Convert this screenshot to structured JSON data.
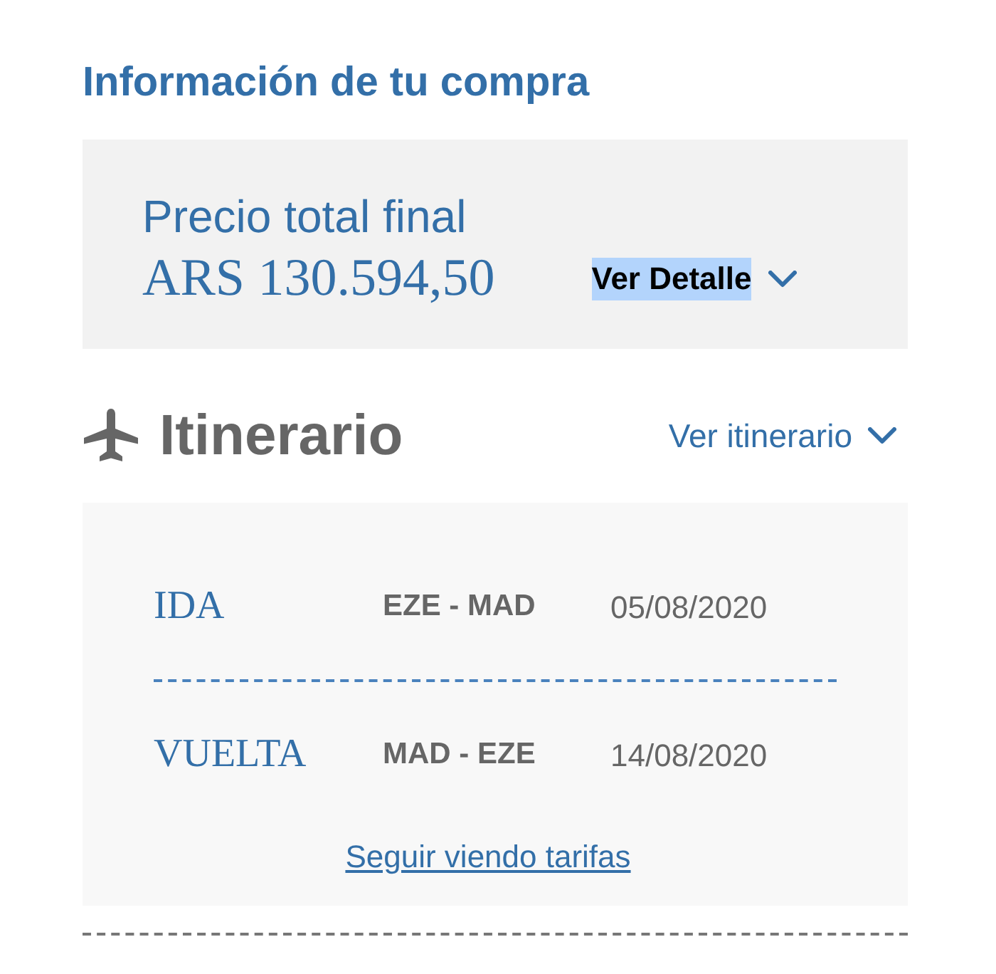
{
  "title": "Información de tu compra",
  "price": {
    "label": "Precio total final",
    "amount": "ARS 130.594,50",
    "detail_link": {
      "label": "Ver Detalle",
      "highlighted": true,
      "expanded": false
    }
  },
  "itinerary": {
    "title": "Itinerario",
    "toggle": {
      "label": "Ver itinerario",
      "expanded": false
    },
    "legs": [
      {
        "label": "IDA",
        "route": "EZE - MAD",
        "date": "05/08/2020"
      },
      {
        "label": "VUELTA",
        "route": "MAD - EZE",
        "date": "14/08/2020"
      }
    ],
    "more_link": "Seguir viendo tarifas"
  }
}
